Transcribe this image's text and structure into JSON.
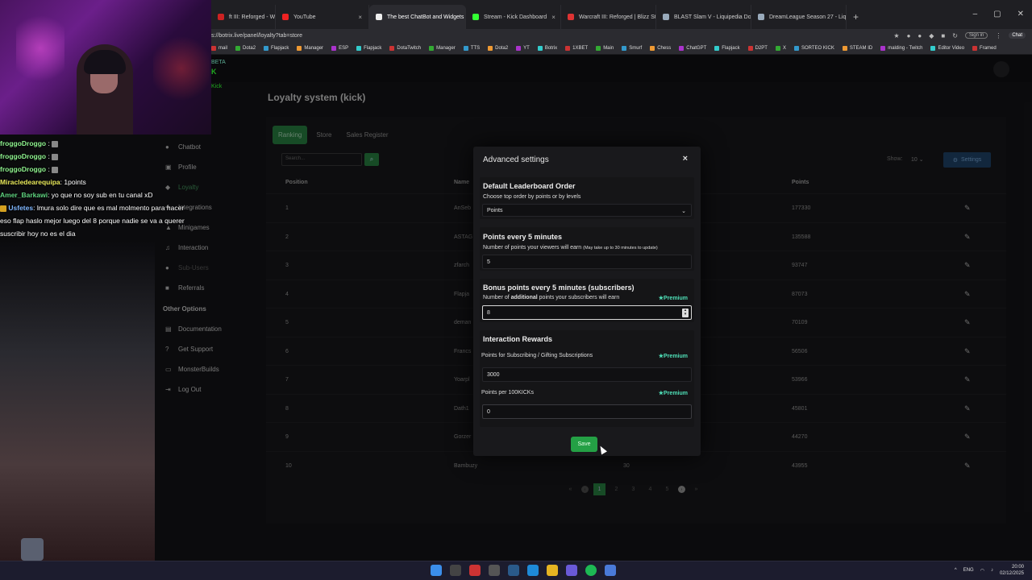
{
  "browser": {
    "tabs": [
      {
        "label": "ft III: Reforged - Warcraft",
        "color": "#c22"
      },
      {
        "label": "YouTube",
        "color": "#e22"
      },
      {
        "label": "The best ChatBot and Widgets fo",
        "color": "#eee",
        "active": true
      },
      {
        "label": "Stream - Kick Dashboard",
        "color": "#3f3"
      },
      {
        "label": "Warcraft III: Reforged | Blizz Store",
        "color": "#d33"
      },
      {
        "label": "BLAST Slam V - Liquipedia Dota 2",
        "color": "#9ab"
      },
      {
        "label": "DreamLeague Season 27 - Liquip",
        "color": "#9ab"
      }
    ],
    "address": "s://botrix.live/panel/loyalty?tab=store",
    "sign_in": "Sign in",
    "chat_label": "Chat",
    "bookmarks": [
      "mail",
      "Dota2",
      "Flapjack",
      "Manager",
      "ESP",
      "Flapjack",
      "DotaTwitch",
      "Manager",
      "TTS",
      "Dota2",
      "YT",
      "Botrix",
      "1XBET",
      "Main",
      "Smurf",
      "Chess",
      "ChatGPT",
      "Flapjack",
      "D2PT",
      "X",
      "SORTEO KICK",
      "STEAM ID",
      "malding - Twitch",
      "Editor Video",
      "Framed"
    ]
  },
  "app": {
    "beta": "BETA",
    "kick_logo": "K",
    "kick_name": "Kick",
    "page_title": "Loyalty system (kick)"
  },
  "sidebar": {
    "items": [
      {
        "label": "Chatbot",
        "icon": "robot-icon",
        "glyph": "●"
      },
      {
        "label": "Profile",
        "icon": "profile-icon",
        "glyph": "▣"
      },
      {
        "label": "Loyalty",
        "icon": "loyalty-icon",
        "glyph": "◆"
      },
      {
        "label": "Integrations",
        "icon": "integrations-icon",
        "glyph": "✚"
      },
      {
        "label": "Minigames",
        "icon": "gamepad-icon",
        "glyph": "▲"
      },
      {
        "label": "Interaction",
        "icon": "music-icon",
        "glyph": "♫"
      },
      {
        "label": "Sub-Users",
        "icon": "users-icon",
        "glyph": "●"
      },
      {
        "label": "Referrals",
        "icon": "referrals-icon",
        "glyph": "■"
      }
    ],
    "other_heading": "Other Options",
    "other_items": [
      {
        "label": "Documentation",
        "icon": "book-icon",
        "glyph": "▤"
      },
      {
        "label": "Get Support",
        "icon": "help-icon",
        "glyph": "?"
      },
      {
        "label": "MonsterBuilds",
        "icon": "monitor-icon",
        "glyph": "▭"
      },
      {
        "label": "Log Out",
        "icon": "logout-icon",
        "glyph": "⇥"
      }
    ]
  },
  "tabs": [
    "Ranking",
    "Store",
    "Sales Register"
  ],
  "search": {
    "placeholder": "Search..."
  },
  "show": {
    "label": "Show:",
    "value": "10"
  },
  "settings_label": "Settings",
  "table": {
    "headers": {
      "position": "Position",
      "name": "Name",
      "points": "Points"
    },
    "rows": [
      {
        "pos": "1",
        "name": "AnSeb",
        "level": "",
        "points": "177330"
      },
      {
        "pos": "2",
        "name": "ASTAG",
        "level": "",
        "points": "135588"
      },
      {
        "pos": "3",
        "name": "zfarch",
        "level": "",
        "points": "93747"
      },
      {
        "pos": "4",
        "name": "Flapja",
        "level": "",
        "points": "87073"
      },
      {
        "pos": "5",
        "name": "deman",
        "level": "",
        "points": "70109"
      },
      {
        "pos": "6",
        "name": "Francs",
        "level": "",
        "points": "56506"
      },
      {
        "pos": "7",
        "name": "Yoarpl",
        "level": "",
        "points": "53966"
      },
      {
        "pos": "8",
        "name": "Dath1",
        "level": "",
        "points": "45801"
      },
      {
        "pos": "9",
        "name": "Gorzer",
        "level": "",
        "points": "44270"
      },
      {
        "pos": "10",
        "name": "Bambuzy",
        "level": "30",
        "points": "43955"
      }
    ]
  },
  "pager": {
    "first": "«",
    "prev": "‹",
    "pages": [
      "1",
      "2",
      "3",
      "4",
      "5"
    ],
    "next": "›",
    "last": "»"
  },
  "modal": {
    "title": "Advanced settings",
    "close": "×",
    "leaderboard": {
      "title": "Default Leaderboard Order",
      "desc": "Choose top order by points or by levels",
      "value": "Points"
    },
    "points5": {
      "title": "Points every 5 minutes",
      "desc": "Number of points your viewers will earn",
      "desc_small": "(May take up to 30 minutes to update)",
      "value": "5"
    },
    "bonus": {
      "title": "Bonus points every 5 minutes (subscribers)",
      "desc_pre": "Number of",
      "desc_bold": "additional",
      "desc_post": "points your subscribers will earn",
      "value": "8"
    },
    "premium_label": "Premium",
    "interaction": {
      "title": "Interaction Rewards",
      "subs_label": "Points for Subscribing / Gifting Subscriptions",
      "subs_value": "3000",
      "kicks_label": "Points per 100KICKs",
      "kicks_value": "0"
    },
    "save": "Save"
  },
  "stream_chat": [
    {
      "user": "froggoDroggo",
      "cls": "u1",
      "text": "",
      "emote": true
    },
    {
      "user": "froggoDroggo",
      "cls": "u1",
      "text": "",
      "emote": true
    },
    {
      "user": "froggoDroggo",
      "cls": "u1",
      "text": "",
      "emote": true
    },
    {
      "user": "Miracledearequipa",
      "cls": "u2",
      "text": ": 1points",
      "emote": false
    },
    {
      "user": "Amer_Barkawi",
      "cls": "u3",
      "text": ": yo que no soy sub en tu canal xD",
      "emote": false
    },
    {
      "user": "Usfetes",
      "cls": "u4",
      "text": ": lmura solo dire que es mal molmento para hacer eso flap haslo mejor luego del 8 porque nadie se va a querer suscribir hoy no es el dia",
      "emote": false
    }
  ],
  "taskbar": {
    "lang": "ENG",
    "time": "20:00",
    "date": "02/12/2025"
  }
}
